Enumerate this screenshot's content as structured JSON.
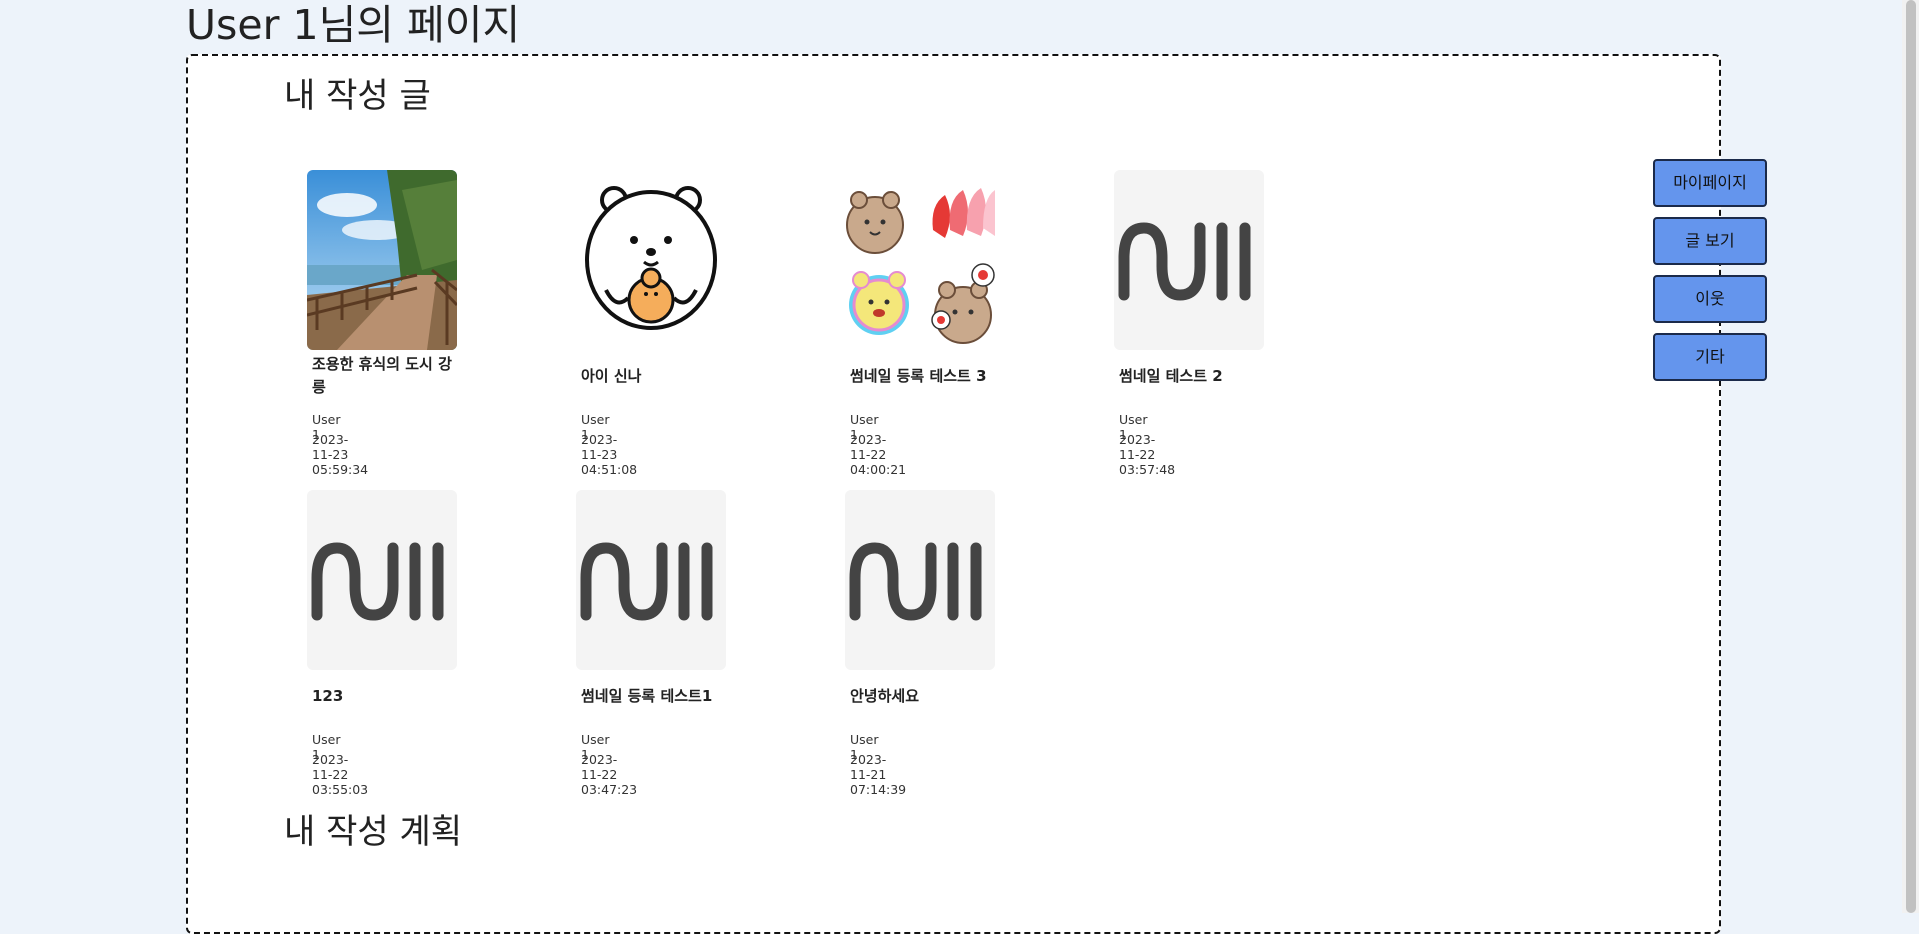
{
  "page_title": "User 1님의 페이지",
  "sections": {
    "posts_title": "내 작성 글",
    "plans_title": "내 작성 계획"
  },
  "posts": [
    {
      "title": "조용한 휴식의 도시 강릉",
      "author": "User 1",
      "date": "2023-11-23 05:59:34",
      "thumbnail": "photo-seaside-boardwalk"
    },
    {
      "title": "아이 신나",
      "author": "User 1",
      "date": "2023-11-23 04:51:08",
      "thumbnail": "bear-character-illustration"
    },
    {
      "title": "썸네일 등록 테스트 3",
      "author": "User 1",
      "date": "2023-11-22 04:00:21",
      "thumbnail": "sticker-collage"
    },
    {
      "title": "썸네일 테스트 2",
      "author": "User 1",
      "date": "2023-11-22 03:57:48",
      "thumbnail": "null-placeholder"
    },
    {
      "title": "123",
      "author": "User 1",
      "date": "2023-11-22 03:55:03",
      "thumbnail": "null-placeholder"
    },
    {
      "title": "썸네일 등록 테스트1",
      "author": "User 1",
      "date": "2023-11-22 03:47:23",
      "thumbnail": "null-placeholder"
    },
    {
      "title": "안녕하세요",
      "author": "User 1",
      "date": "2023-11-21 07:14:39",
      "thumbnail": "null-placeholder"
    }
  ],
  "side_nav": {
    "mypage": "마이페이지",
    "view_posts": "글 보기",
    "neighbors": "이웃",
    "etc": "기타"
  },
  "colors": {
    "page_bg": "#edf3fa",
    "panel_bg": "#ffffff",
    "nav_button": "#6495ed",
    "null_logo": "#444444"
  }
}
